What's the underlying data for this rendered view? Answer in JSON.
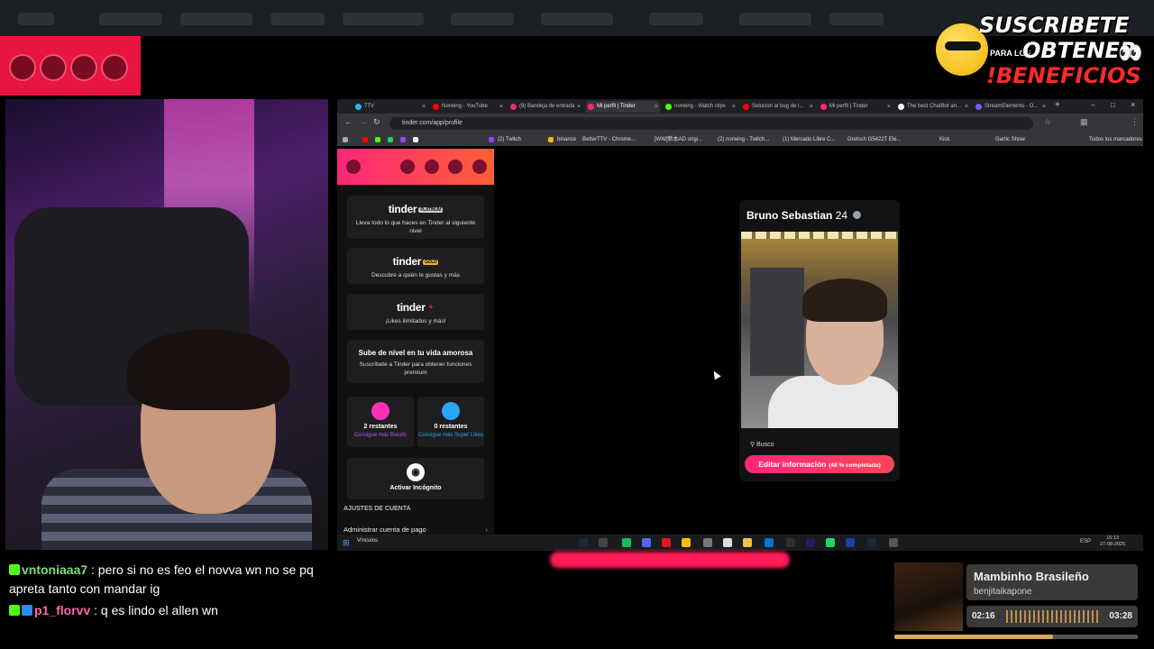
{
  "overlay": {
    "subscribe": {
      "line1": "SUSCRIBETE",
      "para": "PARA LOS",
      "line2": "OBTENER",
      "line3": "!BENEFICIOS"
    },
    "icons": [
      "sunglasses-emoji-icon",
      "eyes-emoji-icon"
    ]
  },
  "chat": [
    {
      "user": "vntoniaaa7",
      "message": ": pero si no es feo el novva wn no se pq apreta tanto con mandar ig"
    },
    {
      "user": "p1_florvv",
      "message": ": q es lindo el allen wn"
    }
  ],
  "browser": {
    "tabs": [
      {
        "label": "7TV"
      },
      {
        "label": "Norwing - YouTube"
      },
      {
        "label": "(9) Bandeja de entrada"
      },
      {
        "label": "Mi perfil | Tinder"
      },
      {
        "label": "norwing - Watch clips"
      },
      {
        "label": "Solucion al bug de l..."
      },
      {
        "label": "Mi perfil | Tinder"
      },
      {
        "label": "The best ChatBot an..."
      },
      {
        "label": "StreamElements - O..."
      }
    ],
    "url": "tinder.com/app/profile",
    "bookmarks": [
      "(2) Twitch",
      "binance",
      "BetterTTV - Chrome...",
      "[WW]新本AD origi...",
      "(2) norwing - Twitch...",
      "(1) Mercado Libre C...",
      "Gretsch G5422T Ele...",
      "Kick",
      "Gartic Show",
      "Todos los marcadores"
    ]
  },
  "sidebar": {
    "cards": [
      {
        "logo": "tinder",
        "tag": "PLATINUM",
        "desc": "Lleva todo lo que haces en Tinder al siguiente nivel"
      },
      {
        "logo": "tinder",
        "tag": "GOLD",
        "desc": "Descubre a quién le gustas y más"
      },
      {
        "logo": "tinder",
        "tag": "+",
        "desc": "¡Likes ilimitados y más!"
      }
    ],
    "upgrade": {
      "title": "Sube de nivel en tu vida amorosa",
      "desc": "Suscríbete a Tinder para obtener funciones premium"
    },
    "boosts": {
      "count": "2 restantes",
      "link": "Consigue más Boosts"
    },
    "superlikes": {
      "count": "0 restantes",
      "link": "Consigue más Super Likes"
    },
    "incognito": "Activar Incógnito",
    "section": "AJUSTES DE CUENTA",
    "account_item": "Administrar cuenta de pago"
  },
  "profile": {
    "name": "Bruno Sebastian",
    "age": "24",
    "busco": "Busco",
    "edit_button": "Editar información",
    "completion": "(48 % completado)"
  },
  "taskbar": {
    "search": "Vínculos",
    "lang": "ESP",
    "time": "16:13",
    "date": "27-08-2025"
  },
  "music": {
    "title": "Mambinho Brasileño",
    "artist": "benjitaikapone",
    "elapsed": "02:16",
    "duration": "03:28",
    "progress": 0.65
  },
  "colors": {
    "tinder_pink": "#fd267a",
    "tinder_orange": "#ff6036",
    "kick_green": "#53fc18"
  }
}
